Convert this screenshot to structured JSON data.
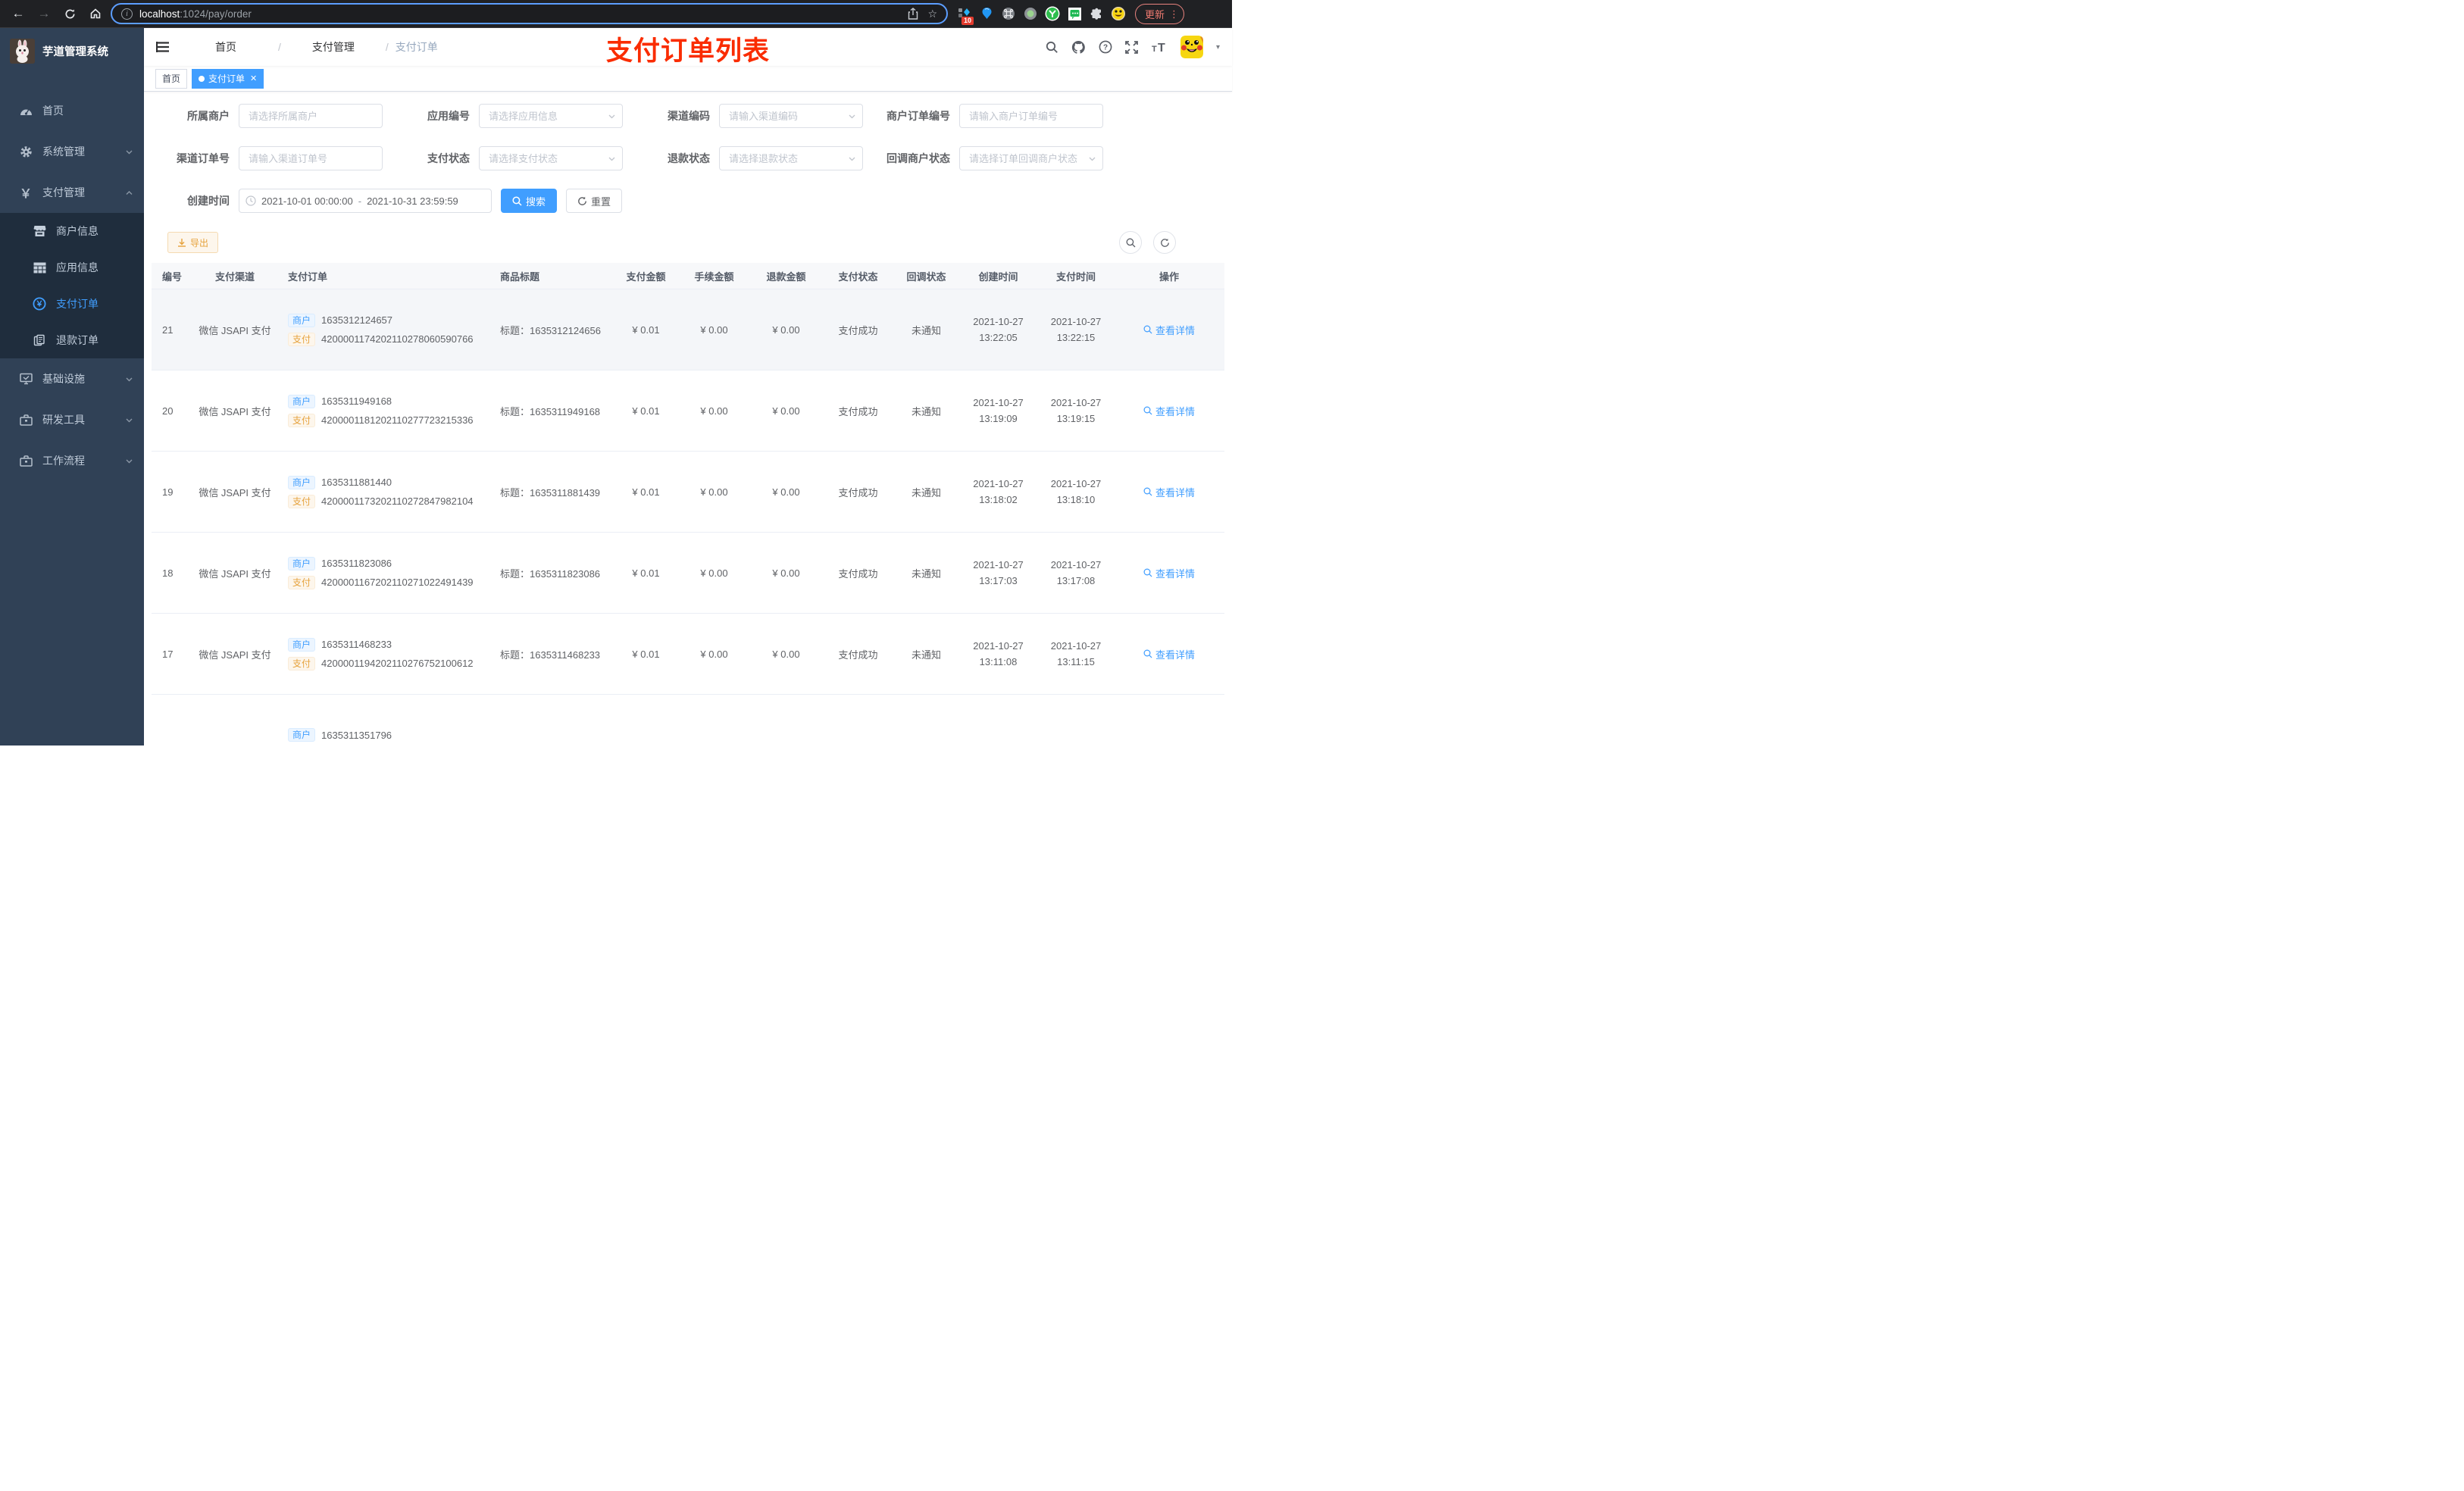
{
  "browser": {
    "url_host": "localhost",
    "url_path": ":1024/pay/order",
    "extension_badge": "10",
    "update_button": "更新"
  },
  "sidebar": {
    "title": "芋道管理系统",
    "items": [
      {
        "label": "首页"
      },
      {
        "label": "系统管理"
      },
      {
        "label": "支付管理"
      },
      {
        "label": "商户信息"
      },
      {
        "label": "应用信息"
      },
      {
        "label": "支付订单"
      },
      {
        "label": "退款订单"
      },
      {
        "label": "基础设施"
      },
      {
        "label": "研发工具"
      },
      {
        "label": "工作流程"
      }
    ]
  },
  "navbar": {
    "breadcrumb": {
      "home": "首页",
      "parent": "支付管理",
      "current": "支付订单"
    },
    "annotation": "支付订单列表"
  },
  "tags": {
    "home": "首页",
    "active": "支付订单"
  },
  "filters": {
    "merchant": {
      "label": "所属商户",
      "placeholder": "请选择所属商户"
    },
    "app": {
      "label": "应用编号",
      "placeholder": "请选择应用信息"
    },
    "channel_code": {
      "label": "渠道编码",
      "placeholder": "请输入渠道编码"
    },
    "merchant_order_no": {
      "label": "商户订单编号",
      "placeholder": "请输入商户订单编号"
    },
    "channel_order_no": {
      "label": "渠道订单号",
      "placeholder": "请输入渠道订单号"
    },
    "pay_status": {
      "label": "支付状态",
      "placeholder": "请选择支付状态"
    },
    "refund_status": {
      "label": "退款状态",
      "placeholder": "请选择退款状态"
    },
    "notify_status": {
      "label": "回调商户状态",
      "placeholder": "请选择订单回调商户状态"
    },
    "create_time": {
      "label": "创建时间",
      "start": "2021-10-01 00:00:00",
      "separator": "-",
      "end": "2021-10-31 23:59:59"
    },
    "search_button": "搜索",
    "reset_button": "重置"
  },
  "toolbar": {
    "export_button": "导出"
  },
  "table": {
    "columns": [
      "编号",
      "支付渠道",
      "支付订单",
      "商品标题",
      "支付金额",
      "手续金额",
      "退款金额",
      "支付状态",
      "回调状态",
      "创建时间",
      "支付时间",
      "操作"
    ],
    "merchant_tag": "商户",
    "pay_tag": "支付",
    "rows": [
      {
        "hover": true,
        "id": "21",
        "channel": "微信 JSAPI 支付",
        "merchant_no": "1635312124657",
        "pay_no": "4200001174202110278060590766",
        "title": "标题：1635312124656",
        "amount": "¥ 0.01",
        "fee": "¥ 0.00",
        "refund": "¥ 0.00",
        "status": "支付成功",
        "notify": "未通知",
        "created_date": "2021-10-27",
        "created_time": "13:22:05",
        "paid_date": "2021-10-27",
        "paid_time": "13:22:15",
        "action": "查看详情"
      },
      {
        "id": "20",
        "channel": "微信 JSAPI 支付",
        "merchant_no": "1635311949168",
        "pay_no": "4200001181202110277723215336",
        "title": "标题：1635311949168",
        "amount": "¥ 0.01",
        "fee": "¥ 0.00",
        "refund": "¥ 0.00",
        "status": "支付成功",
        "notify": "未通知",
        "created_date": "2021-10-27",
        "created_time": "13:19:09",
        "paid_date": "2021-10-27",
        "paid_time": "13:19:15",
        "action": "查看详情"
      },
      {
        "id": "19",
        "channel": "微信 JSAPI 支付",
        "merchant_no": "1635311881440",
        "pay_no": "4200001173202110272847982104",
        "title": "标题：1635311881439",
        "amount": "¥ 0.01",
        "fee": "¥ 0.00",
        "refund": "¥ 0.00",
        "status": "支付成功",
        "notify": "未通知",
        "created_date": "2021-10-27",
        "created_time": "13:18:02",
        "paid_date": "2021-10-27",
        "paid_time": "13:18:10",
        "action": "查看详情"
      },
      {
        "id": "18",
        "channel": "微信 JSAPI 支付",
        "merchant_no": "1635311823086",
        "pay_no": "4200001167202110271022491439",
        "title": "标题：1635311823086",
        "amount": "¥ 0.01",
        "fee": "¥ 0.00",
        "refund": "¥ 0.00",
        "status": "支付成功",
        "notify": "未通知",
        "created_date": "2021-10-27",
        "created_time": "13:17:03",
        "paid_date": "2021-10-27",
        "paid_time": "13:17:08",
        "action": "查看详情"
      },
      {
        "id": "17",
        "channel": "微信 JSAPI 支付",
        "merchant_no": "1635311468233",
        "pay_no": "4200001194202110276752100612",
        "title": "标题：1635311468233",
        "amount": "¥ 0.01",
        "fee": "¥ 0.00",
        "refund": "¥ 0.00",
        "status": "支付成功",
        "notify": "未通知",
        "created_date": "2021-10-27",
        "created_time": "13:11:08",
        "paid_date": "2021-10-27",
        "paid_time": "13:11:15",
        "action": "查看详情"
      },
      {
        "id": "",
        "channel": "",
        "merchant_no": "1635311351796",
        "pay_no": "",
        "title": "",
        "amount": "",
        "fee": "",
        "refund": "",
        "status": "",
        "notify": "",
        "created_date": "",
        "created_time": "",
        "paid_date": "",
        "paid_time": "",
        "action": ""
      }
    ]
  },
  "colors": {
    "accent": "#409eff",
    "warning": "#e6a23c",
    "annotation_red": "#fa2c00",
    "sidebar_bg": "#304156",
    "submenu_bg": "#1f2d3d"
  }
}
